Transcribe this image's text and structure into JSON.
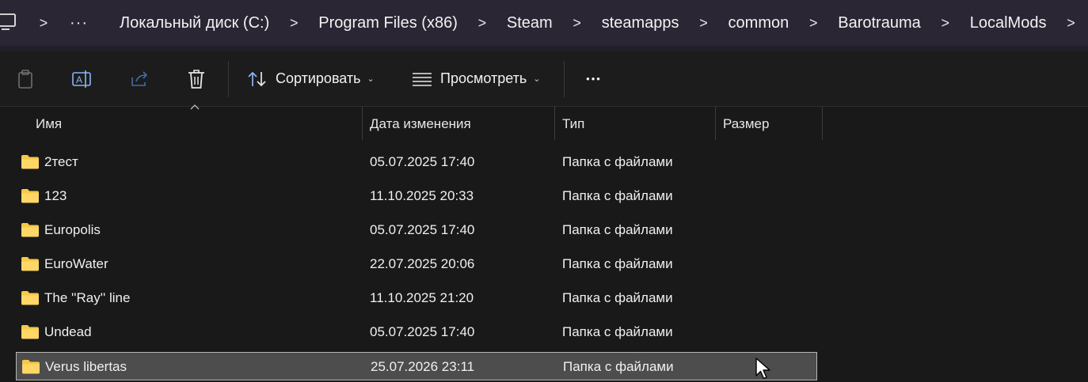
{
  "address": {
    "overflow": "···",
    "crumbs": [
      "Локальный диск (C:)",
      "Program Files (x86)",
      "Steam",
      "steamapps",
      "common",
      "Barotrauma",
      "LocalMods"
    ],
    "separator": ">"
  },
  "toolbar": {
    "sort_label": "Сортировать",
    "view_label": "Просмотреть",
    "more_label": "•••",
    "icons": [
      "copy-icon",
      "rename-icon",
      "share-icon",
      "delete-icon",
      "sort-icon",
      "view-icon",
      "more-icon"
    ]
  },
  "columns": {
    "name": "Имя",
    "date": "Дата изменения",
    "type": "Тип",
    "size": "Размер"
  },
  "rows": [
    {
      "name": "2тест",
      "date": "05.07.2025 17:40",
      "type": "Папка с файлами"
    },
    {
      "name": "123",
      "date": "11.10.2025 20:33",
      "type": "Папка с файлами"
    },
    {
      "name": "Europolis",
      "date": "05.07.2025 17:40",
      "type": "Папка с файлами"
    },
    {
      "name": "EuroWater",
      "date": "22.07.2025 20:06",
      "type": "Папка с файлами"
    },
    {
      "name": "The ''Ray'' line",
      "date": "11.10.2025 21:20",
      "type": "Папка с файлами"
    },
    {
      "name": "Undead",
      "date": "05.07.2025 17:40",
      "type": "Папка с файлами"
    },
    {
      "name": "Verus libertas",
      "date": "25.07.2026 23:11",
      "type": "Папка с файлами",
      "selected": true
    }
  ],
  "colors": {
    "background": "#191919",
    "address_bar": "#2a2634",
    "selection": "#4d4d4d",
    "folder": "#f7c948"
  }
}
